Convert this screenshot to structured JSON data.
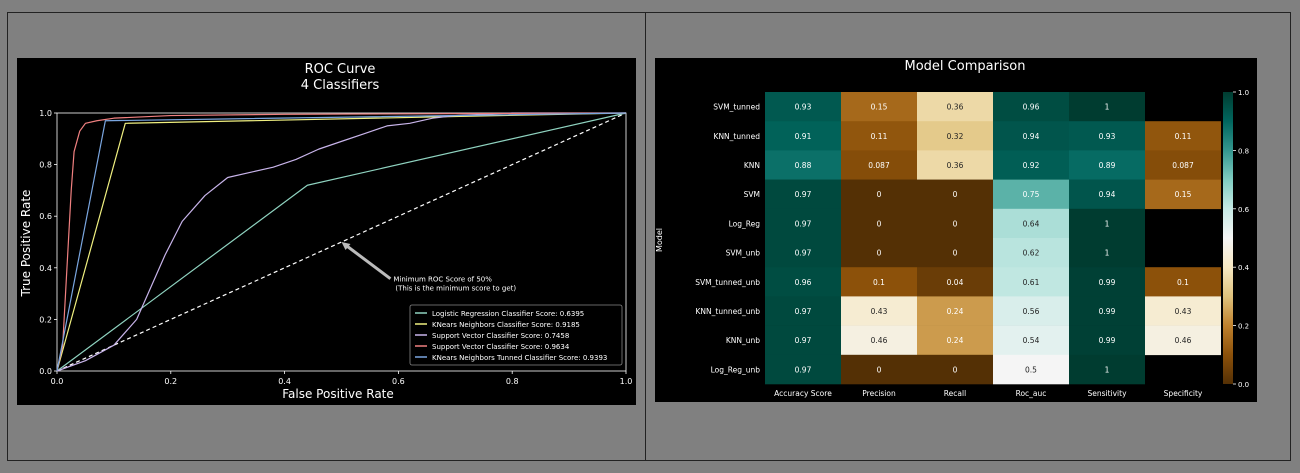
{
  "chart_data": [
    {
      "type": "line",
      "title": "ROC Curve",
      "subtitle": "4 Classifiers",
      "xlabel": "False Positive Rate",
      "ylabel": "True Positive Rate",
      "xlim": [
        0,
        1
      ],
      "ylim": [
        0,
        1
      ],
      "xticks": [
        "0.0",
        "0.2",
        "0.4",
        "0.6",
        "0.8",
        "1.0"
      ],
      "yticks": [
        "0.0",
        "0.2",
        "0.4",
        "0.6",
        "0.8",
        "1.0"
      ],
      "grid": false,
      "legend_position": "lower-right",
      "series": [
        {
          "name": "Logistic Regression Classifier Score: 0.6395",
          "color": "#8fd3c0",
          "points": [
            [
              0,
              0
            ],
            [
              0.44,
              0.72
            ],
            [
              1,
              1
            ]
          ]
        },
        {
          "name": "KNears Neighbors Classifier Score: 0.9185",
          "color": "#f0f080",
          "points": [
            [
              0,
              0
            ],
            [
              0.12,
              0.96
            ],
            [
              1,
              1
            ]
          ]
        },
        {
          "name": "Support Vector Classifier Score: 0.7458",
          "color": "#c8b4ea",
          "points": [
            [
              0,
              0
            ],
            [
              0.05,
              0.04
            ],
            [
              0.1,
              0.1
            ],
            [
              0.14,
              0.2
            ],
            [
              0.16,
              0.3
            ],
            [
              0.19,
              0.45
            ],
            [
              0.22,
              0.58
            ],
            [
              0.26,
              0.68
            ],
            [
              0.3,
              0.75
            ],
            [
              0.34,
              0.77
            ],
            [
              0.38,
              0.79
            ],
            [
              0.42,
              0.82
            ],
            [
              0.46,
              0.86
            ],
            [
              0.5,
              0.89
            ],
            [
              0.54,
              0.92
            ],
            [
              0.58,
              0.95
            ],
            [
              0.62,
              0.96
            ],
            [
              0.66,
              0.98
            ],
            [
              0.7,
              0.99
            ],
            [
              0.8,
              1
            ],
            [
              1,
              1
            ]
          ]
        },
        {
          "name": "Support Vector Classifier Score: 0.9634",
          "color": "#f08080",
          "points": [
            [
              0,
              0
            ],
            [
              0.01,
              0.1
            ],
            [
              0.015,
              0.3
            ],
            [
              0.02,
              0.5
            ],
            [
              0.025,
              0.7
            ],
            [
              0.03,
              0.85
            ],
            [
              0.04,
              0.93
            ],
            [
              0.05,
              0.96
            ],
            [
              0.07,
              0.97
            ],
            [
              0.1,
              0.98
            ],
            [
              0.2,
              0.99
            ],
            [
              0.4,
              0.995
            ],
            [
              1,
              1
            ]
          ]
        },
        {
          "name": "KNears Neighbors Tunned Classifier Score: 0.9393",
          "color": "#7aa6e0",
          "points": [
            [
              0,
              0
            ],
            [
              0.085,
              0.97
            ],
            [
              1,
              1
            ]
          ]
        }
      ],
      "reference_line": {
        "points": [
          [
            0,
            0
          ],
          [
            1,
            1
          ]
        ],
        "style": "dashed",
        "color": "#ffffff"
      },
      "annotation": {
        "text": [
          "Minimum ROC Score of 50%",
          "(This is the minimum score to get)"
        ],
        "target": [
          0.5,
          0.5
        ],
        "text_at": [
          0.6,
          0.35
        ]
      }
    },
    {
      "type": "heatmap",
      "title": "Model Comparison",
      "ylabel": "Model",
      "rows": [
        "SVM_tunned",
        "KNN_tunned",
        "KNN",
        "SVM",
        "Log_Reg",
        "SVM_unb",
        "SVM_tunned_unb",
        "KNN_tunned_unb",
        "KNN_unb",
        "Log_Reg_unb"
      ],
      "columns": [
        "Accuracy Score",
        "Precision",
        "Recall",
        "Roc_auc",
        "Sensitivity",
        "Specificity"
      ],
      "values": [
        [
          0.93,
          0.15,
          0.36,
          0.96,
          1,
          null
        ],
        [
          0.91,
          0.11,
          0.32,
          0.94,
          0.93,
          0.11
        ],
        [
          0.88,
          0.087,
          0.36,
          0.92,
          0.89,
          0.087
        ],
        [
          0.97,
          0,
          0,
          0.75,
          0.94,
          0.15
        ],
        [
          0.97,
          0,
          0,
          0.64,
          1,
          null
        ],
        [
          0.97,
          0,
          0,
          0.62,
          1,
          null
        ],
        [
          0.96,
          0.1,
          0.04,
          0.61,
          0.99,
          0.1
        ],
        [
          0.97,
          0.43,
          0.24,
          0.56,
          0.99,
          0.43
        ],
        [
          0.97,
          0.46,
          0.24,
          0.54,
          0.99,
          0.46
        ],
        [
          0.97,
          0,
          0,
          0.5,
          1,
          null
        ]
      ],
      "labels": [
        [
          "0.93",
          "0.15",
          "0.36",
          "0.96",
          "1",
          ""
        ],
        [
          "0.91",
          "0.11",
          "0.32",
          "0.94",
          "0.93",
          "0.11"
        ],
        [
          "0.88",
          "0.087",
          "0.36",
          "0.92",
          "0.89",
          "0.087"
        ],
        [
          "0.97",
          "0",
          "0",
          "0.75",
          "0.94",
          "0.15"
        ],
        [
          "0.97",
          "0",
          "0",
          "0.64",
          "1",
          ""
        ],
        [
          "0.97",
          "0",
          "0",
          "0.62",
          "1",
          ""
        ],
        [
          "0.96",
          "0.1",
          "0.04",
          "0.61",
          "0.99",
          "0.1"
        ],
        [
          "0.97",
          "0.43",
          "0.24",
          "0.56",
          "0.99",
          "0.43"
        ],
        [
          "0.97",
          "0.46",
          "0.24",
          "0.54",
          "0.99",
          "0.46"
        ],
        [
          "0.97",
          "0",
          "0",
          "0.5",
          "1",
          ""
        ]
      ],
      "colormap": "BrBG",
      "vmin": 0,
      "vmax": 1,
      "colorbar_ticks": [
        "0.0",
        "0.2",
        "0.4",
        "0.6",
        "0.8",
        "1.0"
      ]
    }
  ]
}
